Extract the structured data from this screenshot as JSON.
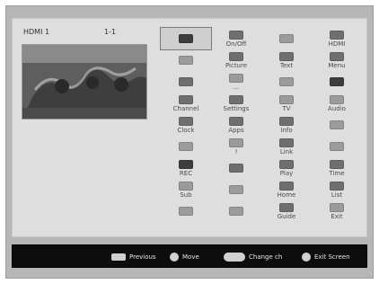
{
  "top_info": {
    "channel_label": "HDMI 1",
    "channel_number": "1-1"
  },
  "thumbnail": {
    "alt": "Horse racing broadcast"
  },
  "grid": {
    "rows": [
      [
        {
          "icon": "circle-icon",
          "label": ""
        },
        {
          "icon": "power-icon",
          "label": "On/Off"
        },
        {
          "icon": "cloud-icon",
          "label": ""
        },
        {
          "icon": "source-icon",
          "label": "HDMI"
        }
      ],
      [
        {
          "icon": "star-icon",
          "label": ""
        },
        {
          "icon": "picture-icon",
          "label": "Picture"
        },
        {
          "icon": "text-icon",
          "label": "Text"
        },
        {
          "icon": "menu-icon",
          "label": "Menu"
        }
      ],
      [
        {
          "icon": "square-icon",
          "label": ""
        },
        {
          "icon": "dots-icon",
          "label": "..."
        },
        {
          "icon": "blank-icon",
          "label": ""
        },
        {
          "icon": "battery-icon",
          "label": ""
        }
      ],
      [
        {
          "icon": "channel-icon",
          "label": "Channel"
        },
        {
          "icon": "settings-icon",
          "label": "Settings"
        },
        {
          "icon": "tv-icon",
          "label": "TV"
        },
        {
          "icon": "audio-icon",
          "label": "Audio"
        }
      ],
      [
        {
          "icon": "clock-icon",
          "label": "Clock"
        },
        {
          "icon": "apps-icon",
          "label": "Apps"
        },
        {
          "icon": "info-icon",
          "label": "Info"
        },
        {
          "icon": "arrow-icon",
          "label": ""
        }
      ],
      [
        {
          "icon": "dot-icon",
          "label": ""
        },
        {
          "icon": "warn-icon",
          "label": "!"
        },
        {
          "icon": "link-icon",
          "label": "Link"
        },
        {
          "icon": "triangle-icon",
          "label": ""
        }
      ],
      [
        {
          "icon": "record-icon",
          "label": "REC"
        },
        {
          "icon": "up-icon",
          "label": ""
        },
        {
          "icon": "play-icon",
          "label": "Play"
        },
        {
          "icon": "time-icon",
          "label": "Time"
        }
      ],
      [
        {
          "icon": "subtitle-icon",
          "label": "Sub"
        },
        {
          "icon": "keyboard-icon",
          "label": ""
        },
        {
          "icon": "home-icon",
          "label": "Home"
        },
        {
          "icon": "list-icon",
          "label": "List"
        }
      ],
      [
        {
          "icon": "minus-icon",
          "label": ""
        },
        {
          "icon": "down-icon",
          "label": ""
        },
        {
          "icon": "guide-icon",
          "label": "Guide"
        },
        {
          "icon": "exit-icon",
          "label": "Exit"
        }
      ]
    ],
    "selected": {
      "row": 0,
      "col": 0
    }
  },
  "bottom_bar": {
    "hints": [
      {
        "key": "ok-key",
        "text": "Previous"
      },
      {
        "key": "move-key",
        "text": "Move"
      },
      {
        "key": "change-key",
        "text": "Change ch"
      },
      {
        "key": "exit-key",
        "text": "Exit Screen"
      }
    ]
  }
}
